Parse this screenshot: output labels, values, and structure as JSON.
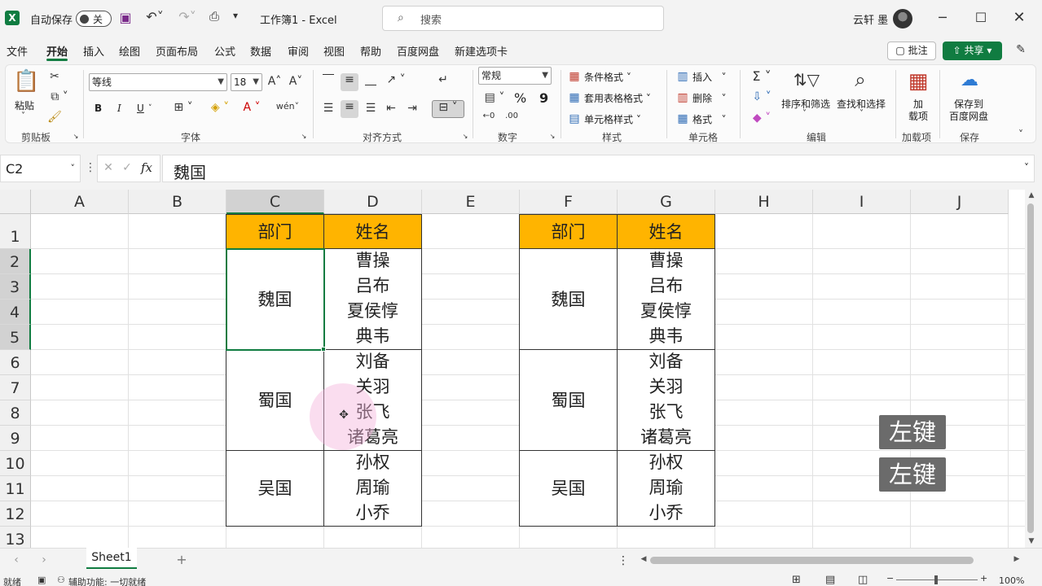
{
  "titlebar": {
    "autosave_label": "自动保存",
    "autosave_state": "关",
    "title": "工作簿1  -  Excel",
    "search_placeholder": "搜索",
    "user_name": "云轩 墨"
  },
  "menu": {
    "items": [
      "文件",
      "开始",
      "插入",
      "绘图",
      "页面布局",
      "公式",
      "数据",
      "审阅",
      "视图",
      "帮助",
      "百度网盘",
      "新建选项卡"
    ],
    "active_index": 1,
    "comment_button": "批注",
    "share_button": "共享"
  },
  "ribbon": {
    "clipboard": {
      "paste_label": "粘贴",
      "group_label": "剪贴板"
    },
    "font": {
      "font_name": "等线",
      "font_size": "18",
      "group_label": "字体",
      "bold": "B",
      "italic": "I",
      "underline": "U"
    },
    "alignment": {
      "group_label": "对齐方式"
    },
    "number": {
      "format": "常规",
      "group_label": "数字",
      "percent": "%",
      "comma": "9"
    },
    "styles": {
      "conditional": "条件格式",
      "table": "套用表格格式",
      "cell": "单元格样式",
      "group_label": "样式"
    },
    "cells": {
      "insert": "插入",
      "delete": "删除",
      "format": "格式",
      "group_label": "单元格"
    },
    "editing": {
      "sort_filter": "排序和筛选",
      "find_select": "查找和选择",
      "group_label": "编辑"
    },
    "addins": {
      "label_line1": "加",
      "label_line2": "载项",
      "group_label": "加载项"
    },
    "save": {
      "label_line1": "保存到",
      "label_line2": "百度网盘",
      "group_label": "保存"
    }
  },
  "formula_bar": {
    "name_box": "C2",
    "fx": "fx",
    "value": "魏国"
  },
  "grid": {
    "columns": [
      "A",
      "B",
      "C",
      "D",
      "E",
      "F",
      "G",
      "H",
      "I",
      "J"
    ],
    "selected_column": "C",
    "rows": [
      "1",
      "2",
      "3",
      "4",
      "5",
      "6",
      "7",
      "8",
      "9",
      "10",
      "11",
      "12",
      "13"
    ],
    "selected_rows": [
      "2",
      "3",
      "4",
      "5"
    ],
    "left_table": {
      "headers": [
        "部门",
        "姓名"
      ],
      "groups": [
        {
          "dept": "魏国",
          "names": [
            "曹操",
            "吕布",
            "夏侯惇",
            "典韦"
          ]
        },
        {
          "dept": "蜀国",
          "names": [
            "刘备",
            "关羽",
            "张飞",
            "诸葛亮"
          ]
        },
        {
          "dept": "吴国",
          "names": [
            "孙权",
            "周瑜",
            "小乔"
          ]
        }
      ]
    },
    "right_table": {
      "headers": [
        "部门",
        "姓名"
      ],
      "groups": [
        {
          "dept": "魏国",
          "names": [
            "曹操",
            "吕布",
            "夏侯惇",
            "典韦"
          ]
        },
        {
          "dept": "蜀国",
          "names": [
            "刘备",
            "关羽",
            "张飞",
            "诸葛亮"
          ]
        },
        {
          "dept": "吴国",
          "names": [
            "孙权",
            "周瑜",
            "小乔"
          ]
        }
      ]
    },
    "key_overlays": [
      "左键",
      "左键"
    ]
  },
  "sheets": {
    "tabs": [
      "Sheet1"
    ],
    "active": "Sheet1"
  },
  "status": {
    "ready": "就绪",
    "accessibility": "辅助功能: 一切就绪",
    "zoom": "100%"
  },
  "colors": {
    "accent": "#107c41",
    "header_fill": "#ffb400"
  }
}
